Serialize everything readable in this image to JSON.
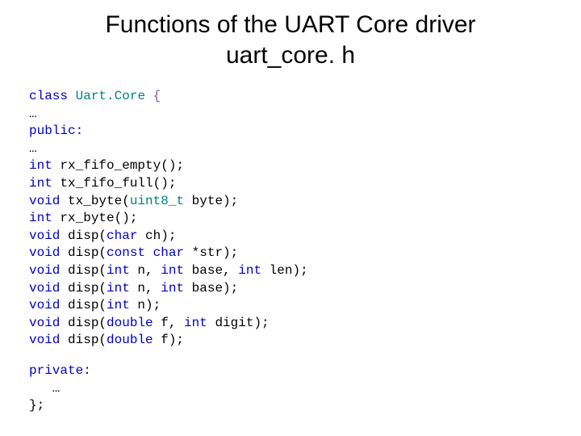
{
  "title": {
    "line1": "Functions of the UART Core driver",
    "line2": "uart_core. h"
  },
  "code": {
    "l01_kw_class": "class",
    "l01_cls": "Uart.Core",
    "l01_brace": "{",
    "l02_ellipsis": "…",
    "l03_kw": "public:",
    "l04_ellipsis": "…",
    "l05_kw": "int",
    "l05_rest": " rx_fifo_empty();",
    "l06_kw": "int",
    "l06_rest": " tx_fifo_full();",
    "l07_kw": "void",
    "l07_mid": " tx_byte(",
    "l07_type": "uint8_t",
    "l07_rest": " byte);",
    "l08_kw": "int",
    "l08_rest": " rx_byte();",
    "l09_kw": "void",
    "l09_mid": " disp(",
    "l09_kw2": "char",
    "l09_rest": " ch);",
    "l10_kw": "void",
    "l10_mid": " disp(",
    "l10_kw2": "const char",
    "l10_rest": " *str);",
    "l11_kw": "void",
    "l11_mid": " disp(",
    "l11_kw2": "int",
    "l11_mid2": " n, ",
    "l11_kw3": "int",
    "l11_mid3": " base, ",
    "l11_kw4": "int",
    "l11_rest": " len);",
    "l12_kw": "void",
    "l12_mid": " disp(",
    "l12_kw2": "int",
    "l12_mid2": " n, ",
    "l12_kw3": "int",
    "l12_rest": " base);",
    "l13_kw": "void",
    "l13_mid": " disp(",
    "l13_kw2": "int",
    "l13_rest": " n);",
    "l14_kw": "void",
    "l14_mid": " disp(",
    "l14_kw2": "double",
    "l14_mid2": " f, ",
    "l14_kw3": "int",
    "l14_rest": " digit);",
    "l15_kw": "void",
    "l15_mid": " disp(",
    "l15_kw2": "double",
    "l15_rest": " f);",
    "l17_kw": "private:",
    "l18_ellipsis": "   …",
    "l19_end": "};"
  }
}
